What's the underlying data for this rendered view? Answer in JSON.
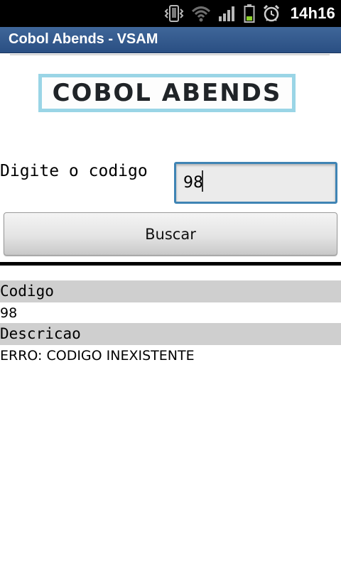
{
  "status_bar": {
    "time": "14h16",
    "icons": [
      "vibrate-icon",
      "wifi-icon",
      "signal-icon",
      "battery-icon",
      "alarm-icon"
    ]
  },
  "app": {
    "title": "Cobol Abends - VSAM",
    "logo_text": "COBOL ABENDS",
    "logo_border_color": "#9ad5e6",
    "title_bar_color": "#2f5a8f"
  },
  "form": {
    "code_label": "Digite o codigo",
    "code_value": "98",
    "search_button_label": "Buscar",
    "input_border_color": "#3f84b4"
  },
  "results": {
    "code_header": "Codigo",
    "code_value": "98",
    "description_header": "Descricao",
    "description_value": "ERRO: CODIGO INEXISTENTE"
  }
}
